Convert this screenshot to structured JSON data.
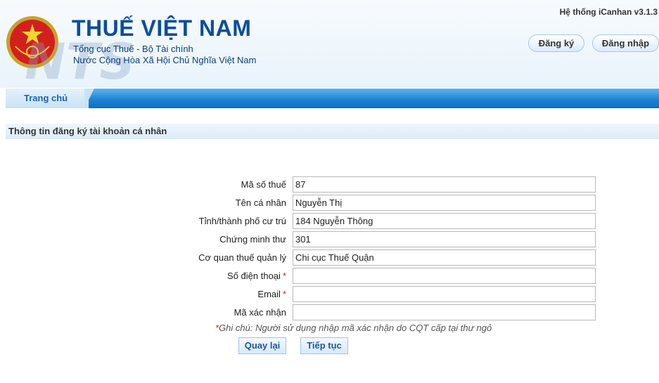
{
  "header": {
    "title": "THUẾ VIỆT NAM",
    "subtitle_1": "Tổng cục Thuế - Bộ Tài chính",
    "subtitle_2": "Nước Cộng Hòa Xã Hội Chủ Nghĩa Việt Nam",
    "emblem_text": "THUẾ NHÀ NƯỚC",
    "system_version": "Hệ thống iCanhan v3.1.3",
    "register_label": "Đăng ký",
    "login_label": "Đăng nhập"
  },
  "nav": {
    "home_label": "Trang chủ"
  },
  "section": {
    "title": "Thông tin đăng ký tài khoản cá nhân"
  },
  "form": {
    "fields": [
      {
        "label": "Mã số thuế",
        "value": "87",
        "required": false
      },
      {
        "label": "Tên cá nhân",
        "value": "Nguyễn Thị",
        "required": false
      },
      {
        "label": "Tỉnh/thành phố cư trú",
        "value": "184 Nguyễn Thông",
        "required": false
      },
      {
        "label": "Chứng minh thư",
        "value": "301",
        "required": false
      },
      {
        "label": "Cơ quan thuế quản lý",
        "value": "Chi cục Thuế Quận",
        "required": false
      },
      {
        "label": "Số điện thoại",
        "value": "",
        "required": true
      },
      {
        "label": "Email",
        "value": "",
        "required": true
      },
      {
        "label": "Mã xác nhận",
        "value": "",
        "required": false
      }
    ],
    "required_mark": "*",
    "note": "Ghi chú: Người sử dụng nhập mã xác nhận do CQT cấp tại thư ngỏ",
    "back_label": "Quay lại",
    "next_label": "Tiếp tục"
  },
  "colors": {
    "brand": "#0a4e9c",
    "nav": "#1d84d6",
    "required": "#d21b1b"
  }
}
